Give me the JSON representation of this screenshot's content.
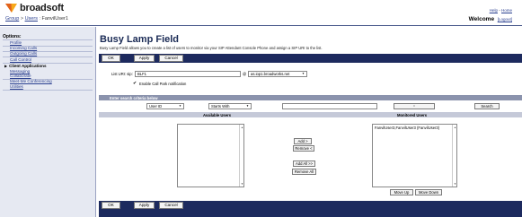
{
  "header": {
    "logo_text": "broadsoft",
    "breadcrumb": [
      "Group",
      "Users",
      "FanvilUser1"
    ],
    "help_link": "Help",
    "home_link": "Home",
    "welcome_label": "Welcome",
    "logout_link": "[Logout]"
  },
  "sidebar": {
    "title": "Options:",
    "items": [
      {
        "label": "Profile"
      },
      {
        "label": "Incoming Calls"
      },
      {
        "label": "Outgoing Calls"
      },
      {
        "label": "Call Control"
      },
      {
        "label": "Client Applications"
      },
      {
        "label": "Messaging"
      },
      {
        "label": "Collaborate"
      },
      {
        "label": "Meet-Me Conferencing"
      },
      {
        "label": "Utilities"
      }
    ]
  },
  "main": {
    "title": "Busy Lamp Field",
    "description": "Busy Lamp Field allows you to create a list of users to monitor via your SIP Attendant Console Phone and assign a SIP URI to the list.",
    "top_buttons": {
      "ok": "OK",
      "apply": "Apply",
      "cancel": "Cancel"
    },
    "bottom_buttons": {
      "ok": "OK",
      "apply": "Apply",
      "cancel": "Cancel"
    },
    "list_uri_label": "List URI: sip:",
    "list_uri_value": "BLF1",
    "at_sign": "@",
    "domain_value": "as.iop1.broadworks.net",
    "enable_call_park_label": "Enable Call Park notification",
    "search_header": "Enter search criteria below",
    "search_field": "User ID",
    "search_mode": "Starts With",
    "search_value": "",
    "search_button": "Search",
    "available_users_label": "Available Users",
    "monitored_users_label": "Monitored Users",
    "available_users": [],
    "monitored_users": [
      "FanvilUser3,FanvilUser3 (FanvilUser3)"
    ],
    "add_button": "Add >",
    "remove_button": "Remove <",
    "add_all_button": "Add All >>",
    "remove_all_button": "Remove All",
    "move_up_button": "Move Up",
    "move_down_button": "Move Down"
  },
  "colors": {
    "toolbar_bg": "#1d2a5e",
    "link": "#2a3f8f",
    "sidebar_bg": "#e6e9f2"
  }
}
